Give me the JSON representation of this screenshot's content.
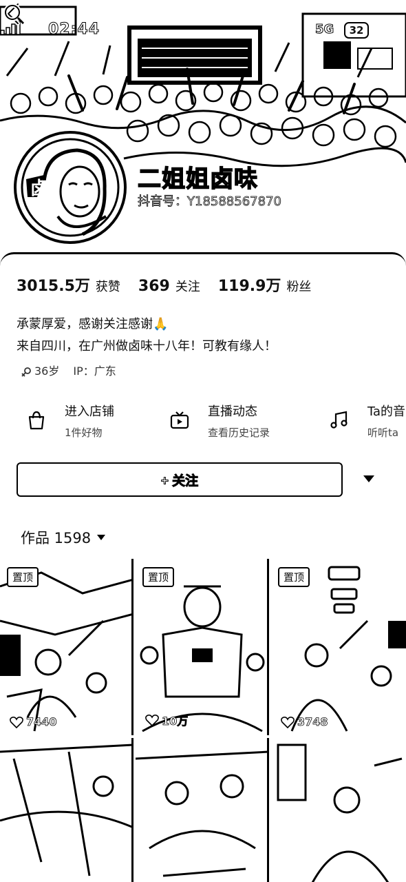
{
  "status_bar": {
    "time": "02:44",
    "network": "5G",
    "battery": "32"
  },
  "profile": {
    "name": "二姐姐卤味",
    "handle": "抖音号：Y18588567870",
    "stats": [
      {
        "value": "3015.5万",
        "label": "获赞"
      },
      {
        "value": "369",
        "label": "关注"
      },
      {
        "value": "119.9万",
        "label": "粉丝"
      }
    ],
    "bio_lines": [
      "承蒙厚爱，感谢关注感谢🙏",
      "来自四川，在广州做卤味十八年！可教有缘人！"
    ],
    "age": "36岁",
    "ip": "IP：广东"
  },
  "entries": [
    {
      "title": "进入店铺",
      "subtitle": "1件好物",
      "icon": "shopping-bag-icon"
    },
    {
      "title": "直播动态",
      "subtitle": "查看历史记录",
      "icon": "live-tv-icon"
    },
    {
      "title": "Ta的音",
      "subtitle": "听听ta",
      "icon": "music-note-icon"
    }
  ],
  "follow_button": {
    "label": "+ 关注"
  },
  "works": {
    "label": "作品 1598",
    "tiles": [
      {
        "pin": "置顶",
        "likes": "7440"
      },
      {
        "pin": "置顶",
        "likes": "10万"
      },
      {
        "pin": "置顶",
        "likes": "3748"
      },
      {
        "pin": "",
        "likes": ""
      },
      {
        "pin": "",
        "likes": ""
      },
      {
        "pin": "",
        "likes": ""
      }
    ]
  }
}
